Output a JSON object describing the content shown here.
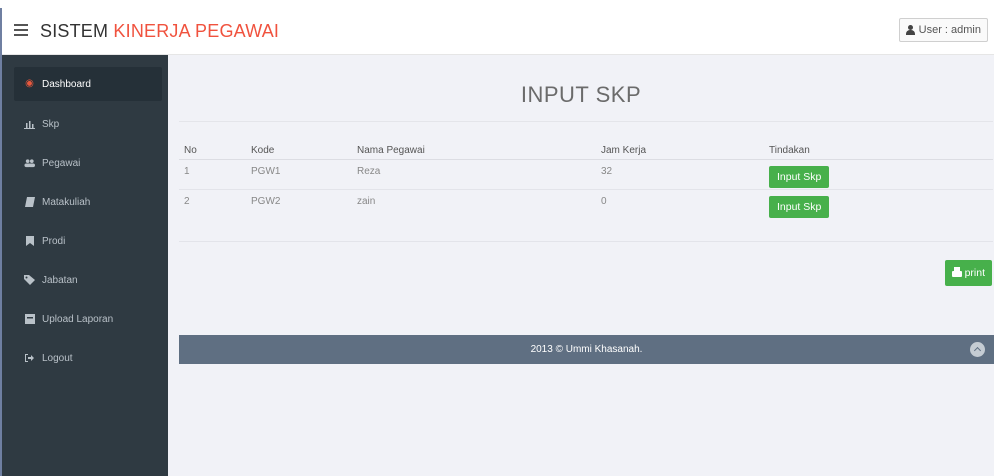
{
  "header": {
    "brand_prefix": "SISTEM ",
    "brand_accent": "KINERJA PEGAWAI",
    "user_label": "User : admin"
  },
  "sidebar": {
    "items": [
      {
        "label": "Dashboard",
        "icon": "dashboard-icon"
      },
      {
        "label": "Skp",
        "icon": "bar-chart-icon"
      },
      {
        "label": "Pegawai",
        "icon": "users-icon"
      },
      {
        "label": "Matakuliah",
        "icon": "book-icon"
      },
      {
        "label": "Prodi",
        "icon": "bookmark-icon"
      },
      {
        "label": "Jabatan",
        "icon": "tag-icon"
      },
      {
        "label": "Upload Laporan",
        "icon": "upload-icon"
      },
      {
        "label": "Logout",
        "icon": "logout-icon"
      }
    ]
  },
  "main": {
    "title": "INPUT SKP",
    "table": {
      "headers": [
        "No",
        "Kode",
        "Nama Pegawai",
        "Jam Kerja",
        "Tindakan"
      ],
      "rows": [
        {
          "no": "1",
          "kode": "PGW1",
          "nama": "Reza",
          "jam": "32",
          "action": "Input Skp"
        },
        {
          "no": "2",
          "kode": "PGW2",
          "nama": "zain",
          "jam": "0",
          "action": "Input Skp"
        }
      ]
    },
    "print_label": "print"
  },
  "footer": {
    "text": "2013 © Ummi Khasanah."
  },
  "colors": {
    "accent": "#f0523e",
    "sidebar_bg": "#2f3a42",
    "button_green": "#47b04b",
    "footer_bg": "#5f6f82"
  }
}
